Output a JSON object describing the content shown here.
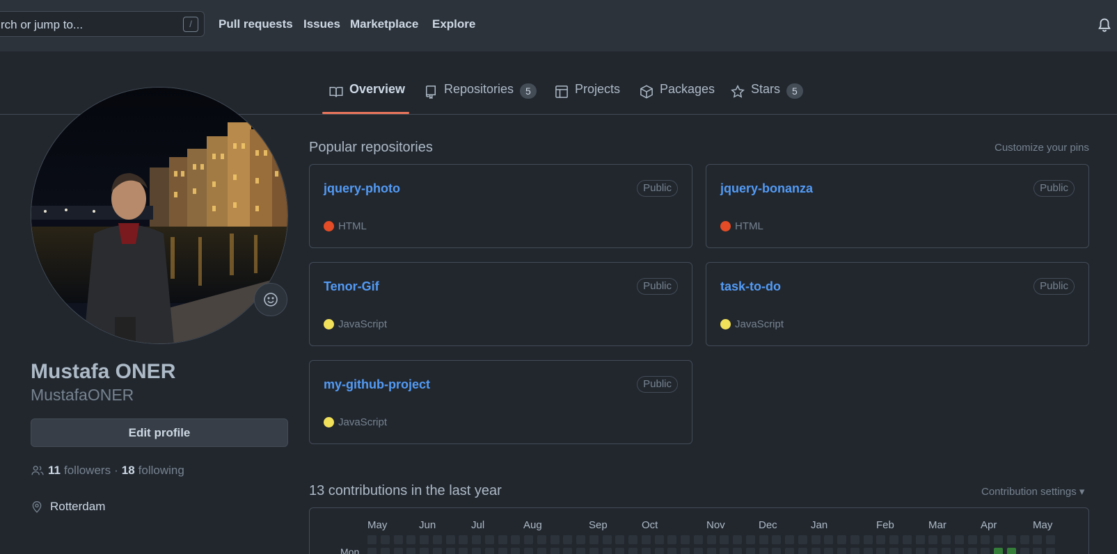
{
  "header": {
    "search_placeholder": "rch or jump to...",
    "slash_key": "/",
    "nav": [
      "Pull requests",
      "Issues",
      "Marketplace",
      "Explore"
    ]
  },
  "tabs": [
    {
      "label": "Overview",
      "icon": "book-icon",
      "selected": true
    },
    {
      "label": "Repositories",
      "icon": "repo-icon",
      "count": "5"
    },
    {
      "label": "Projects",
      "icon": "table-icon"
    },
    {
      "label": "Packages",
      "icon": "package-icon"
    },
    {
      "label": "Stars",
      "icon": "star-icon",
      "count": "5"
    }
  ],
  "profile": {
    "fullname": "Mustafa ONER",
    "username": "MustafaONER",
    "edit_label": "Edit profile",
    "followers_count": "11",
    "followers_label": "followers",
    "separator": "·",
    "following_count": "18",
    "following_label": "following",
    "location": "Rotterdam"
  },
  "pinned": {
    "title": "Popular repositories",
    "customize": "Customize your pins",
    "repos": [
      {
        "name": "jquery-photo",
        "visibility": "Public",
        "language": "HTML",
        "lang_color": "#e34c26"
      },
      {
        "name": "jquery-bonanza",
        "visibility": "Public",
        "language": "HTML",
        "lang_color": "#e34c26"
      },
      {
        "name": "Tenor-Gif",
        "visibility": "Public",
        "language": "JavaScript",
        "lang_color": "#f1e05a"
      },
      {
        "name": "task-to-do",
        "visibility": "Public",
        "language": "JavaScript",
        "lang_color": "#f1e05a"
      },
      {
        "name": "my-github-project",
        "visibility": "Public",
        "language": "JavaScript",
        "lang_color": "#f1e05a"
      }
    ]
  },
  "contributions": {
    "title": "13 contributions in the last year",
    "settings": "Contribution settings ▾",
    "months": [
      "May",
      "Jun",
      "Jul",
      "Aug",
      "Sep",
      "Oct",
      "Nov",
      "Dec",
      "Jan",
      "Feb",
      "Mar",
      "Apr",
      "May"
    ],
    "day_label": "Mon"
  },
  "colors": {
    "accent": "#ec775c",
    "link": "#539bf5",
    "contrib_active": "#347d39"
  }
}
